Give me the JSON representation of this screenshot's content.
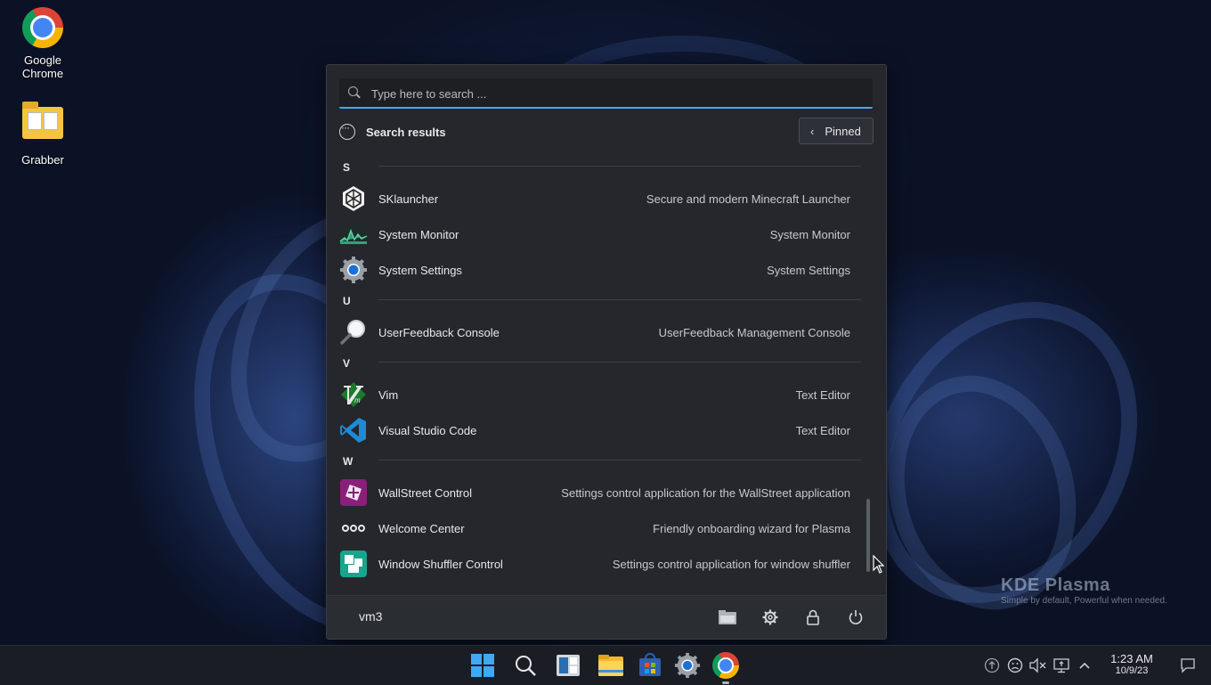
{
  "desktop": {
    "icons": [
      {
        "label_line1": "Google",
        "label_line2": "Chrome",
        "icon": "chrome-icon"
      },
      {
        "label": "Grabber",
        "icon": "folder-icon"
      }
    ],
    "watermark": {
      "title": "KDE Plasma",
      "tagline": "Simple by default, Powerful when  needed."
    }
  },
  "launcher": {
    "search": {
      "placeholder": "Type here to search ...",
      "value": ""
    },
    "header": {
      "title": "Search results",
      "pinned_button": "Pinned"
    },
    "sections": [
      {
        "letter": "S",
        "items": [
          {
            "name": "SKlauncher",
            "description": "Secure and modern Minecraft Launcher",
            "icon": "sklauncher-icon"
          },
          {
            "name": "System Monitor",
            "description": "System Monitor",
            "icon": "system-monitor-icon"
          },
          {
            "name": "System Settings",
            "description": "System Settings",
            "icon": "system-settings-icon"
          }
        ]
      },
      {
        "letter": "U",
        "items": [
          {
            "name": "UserFeedback Console",
            "description": "UserFeedback Management Console",
            "icon": "magnifier-icon"
          }
        ]
      },
      {
        "letter": "V",
        "items": [
          {
            "name": "Vim",
            "description": "Text Editor",
            "icon": "vim-icon"
          },
          {
            "name": "Visual Studio Code",
            "description": "Text Editor",
            "icon": "vscode-icon"
          }
        ]
      },
      {
        "letter": "W",
        "items": [
          {
            "name": "WallStreet Control",
            "description": "Settings control application for the WallStreet application",
            "icon": "wallstreet-icon"
          },
          {
            "name": "Welcome Center",
            "description": "Friendly onboarding wizard for Plasma",
            "icon": "welcome-center-icon"
          },
          {
            "name": "Window Shuffler Control",
            "description": "Settings control application for window shuffler",
            "icon": "window-shuffler-icon"
          }
        ]
      }
    ],
    "footer": {
      "user": "vm3",
      "buttons": [
        "file-manager-icon",
        "settings-gear-icon",
        "lock-icon",
        "power-icon"
      ]
    }
  },
  "taskbar": {
    "apps": [
      "start-menu-icon",
      "search-icon",
      "widgets-icon",
      "file-explorer-icon",
      "store-icon",
      "system-settings-icon",
      "chrome-icon"
    ],
    "tray": [
      "update-icon",
      "feedback-icon",
      "volume-muted-icon",
      "network-icon",
      "chevron-up-icon"
    ],
    "time": "1:23 AM",
    "date": "10/9/23",
    "notification": "notification-icon"
  },
  "colors": {
    "accent": "#3daee9",
    "panel": "#25272c",
    "desktop_bg": "#0b1226"
  }
}
